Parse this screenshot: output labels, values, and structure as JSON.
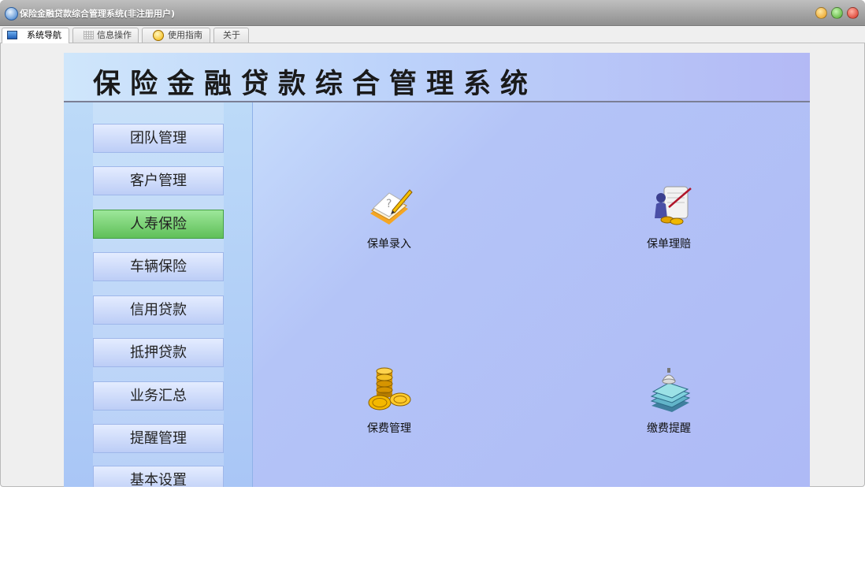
{
  "window": {
    "title": "保险金融贷款综合管理系统(非注册用户)"
  },
  "tabs": [
    {
      "label": "系统导航"
    },
    {
      "label": "信息操作"
    },
    {
      "label": "使用指南"
    },
    {
      "label": "关于"
    }
  ],
  "banner": {
    "title": "保险金融贷款综合管理系统"
  },
  "sidebar": {
    "active": "人寿保险",
    "items": [
      {
        "label": "团队管理"
      },
      {
        "label": "客户管理"
      },
      {
        "label": "人寿保险"
      },
      {
        "label": "车辆保险"
      },
      {
        "label": "信用贷款"
      },
      {
        "label": "抵押贷款"
      },
      {
        "label": "业务汇总"
      },
      {
        "label": "提醒管理"
      },
      {
        "label": "基本设置"
      }
    ]
  },
  "main": {
    "tiles": [
      {
        "label": "保单录入",
        "icon": "notepad-pencil-icon"
      },
      {
        "label": "保单理赔",
        "icon": "person-scroll-coins-icon"
      },
      {
        "label": "保费管理",
        "icon": "gold-coins-icon"
      },
      {
        "label": "缴费提醒",
        "icon": "books-lamp-icon"
      }
    ]
  }
}
